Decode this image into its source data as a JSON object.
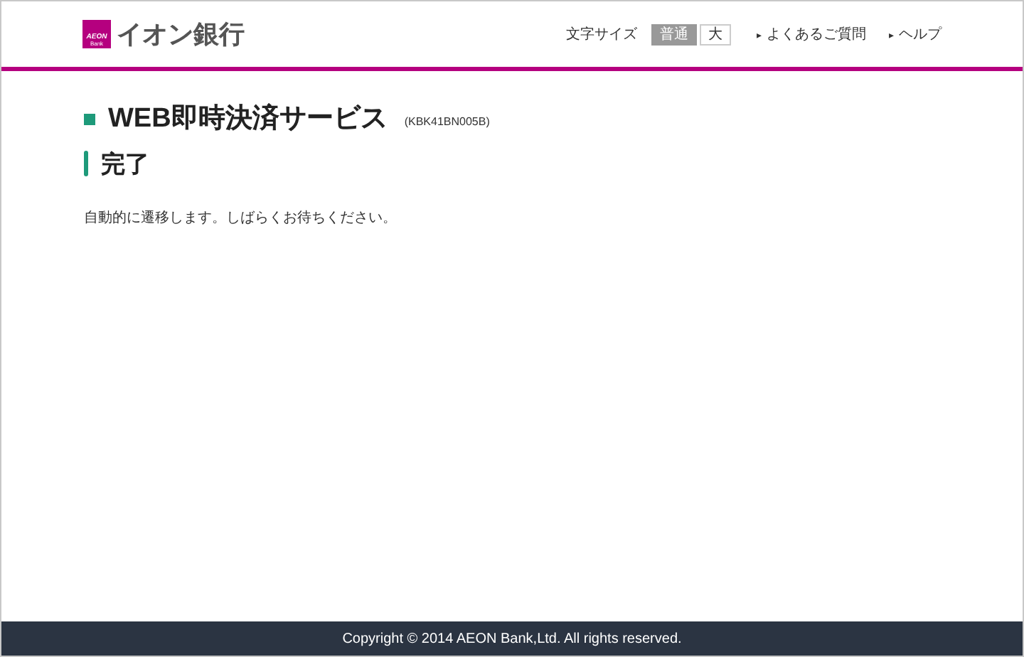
{
  "header": {
    "logo": {
      "mark": "AEON",
      "sub": "Bank",
      "name": "イオン銀行"
    },
    "font_size": {
      "label": "文字サイズ",
      "options": [
        {
          "label": "普通",
          "selected": true
        },
        {
          "label": "大",
          "selected": false
        }
      ]
    },
    "links": [
      {
        "icon": "▸",
        "label": "よくあるご質問"
      },
      {
        "icon": "▸",
        "label": "ヘルプ"
      }
    ]
  },
  "main": {
    "title": "WEB即時決済サービス",
    "code": "(KBK41BN005B)",
    "subtitle": "完了",
    "message": "自動的に遷移します。しばらくお待ちください。"
  },
  "footer": {
    "copyright": "Copyright © 2014 AEON Bank,Ltd. All rights reserved."
  }
}
